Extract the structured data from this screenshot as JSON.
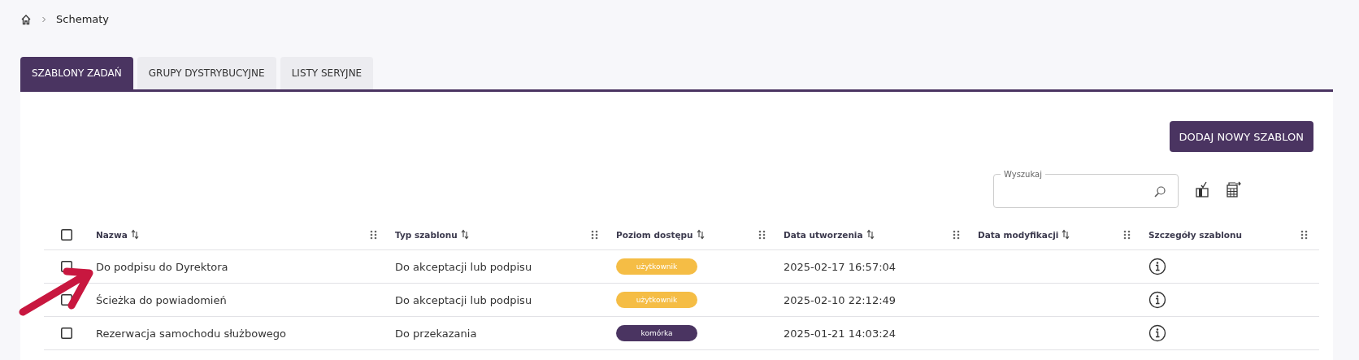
{
  "breadcrumb": {
    "current": "Schematy"
  },
  "tabs": [
    {
      "label": "SZABLONY ZADAŃ",
      "selected": true
    },
    {
      "label": "GRUPY DYSTRYBUCYJNE",
      "selected": false
    },
    {
      "label": "LISTY SERYJNE",
      "selected": false
    }
  ],
  "add_button": "DODAJ NOWY SZABLON",
  "search": {
    "label": "Wyszukaj"
  },
  "table": {
    "select_all": {
      "checked": false
    },
    "columns": [
      {
        "label": "Nazwa",
        "sortable": true
      },
      {
        "label": "Typ szablonu",
        "sortable": true
      },
      {
        "label": "Poziom dostępu",
        "sortable": true
      },
      {
        "label": "Data utworzenia",
        "sortable": true
      },
      {
        "label": "Data modyfikacji",
        "sortable": true
      },
      {
        "label": "Szczegóły szablonu",
        "sortable": false
      }
    ],
    "rows": [
      {
        "checked": false,
        "name": "Do podpisu do Dyrektora",
        "type": "Do akceptacji lub podpisu",
        "access": {
          "label": "użytkownik",
          "color": "#f5bd45"
        },
        "created": "2025-02-17 16:57:04"
      },
      {
        "checked": false,
        "name": "Ścieżka do powiadomień",
        "type": "Do akceptacji lub podpisu",
        "access": {
          "label": "użytkownik",
          "color": "#f5bd45"
        },
        "created": "2025-02-10 22:12:49"
      },
      {
        "checked": false,
        "name": "Rezerwacja samochodu służbowego",
        "type": "Do przekazania",
        "access": {
          "label": "komórka",
          "color": "#4a3461"
        },
        "created": "2025-01-21 14:03:24"
      }
    ]
  }
}
